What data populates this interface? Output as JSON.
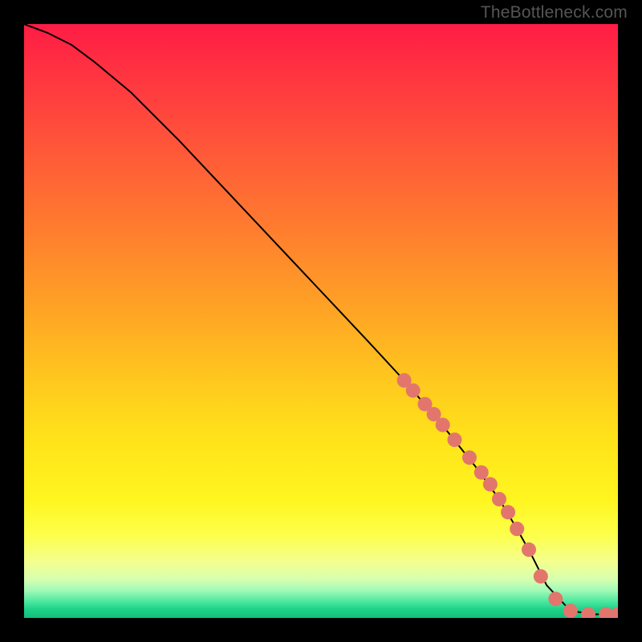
{
  "watermark": "TheBottleneck.com",
  "colors": {
    "frame": "#000000",
    "curve": "#000000",
    "marker_fill": "#e2766c",
    "marker_stroke": "#d46058",
    "gradient_stops": [
      {
        "offset": 0.0,
        "color": "#ff1c45"
      },
      {
        "offset": 0.1,
        "color": "#ff3840"
      },
      {
        "offset": 0.22,
        "color": "#ff5a38"
      },
      {
        "offset": 0.35,
        "color": "#ff7e2e"
      },
      {
        "offset": 0.48,
        "color": "#ffa325"
      },
      {
        "offset": 0.6,
        "color": "#ffc81e"
      },
      {
        "offset": 0.7,
        "color": "#ffe31a"
      },
      {
        "offset": 0.8,
        "color": "#fff51f"
      },
      {
        "offset": 0.86,
        "color": "#fdff4a"
      },
      {
        "offset": 0.905,
        "color": "#f4ff8e"
      },
      {
        "offset": 0.935,
        "color": "#d7ffb0"
      },
      {
        "offset": 0.955,
        "color": "#9cf9b6"
      },
      {
        "offset": 0.972,
        "color": "#4de8a0"
      },
      {
        "offset": 0.985,
        "color": "#1fd289"
      },
      {
        "offset": 1.0,
        "color": "#11bf7b"
      }
    ]
  },
  "chart_data": {
    "type": "line",
    "title": "",
    "xlabel": "",
    "ylabel": "",
    "xlim": [
      0,
      100
    ],
    "ylim": [
      0,
      100
    ],
    "series": [
      {
        "name": "bottleneck-curve",
        "x": [
          0,
          4,
          8,
          12,
          18,
          26,
          34,
          42,
          50,
          58,
          64,
          70,
          76,
          80,
          83,
          85.5,
          88,
          92,
          96,
          100
        ],
        "y": [
          100,
          98.5,
          96.5,
          93.5,
          88.5,
          80.5,
          72,
          63.5,
          55,
          46.5,
          40,
          33,
          25.5,
          20,
          15,
          10.5,
          5.5,
          1.2,
          0.6,
          0.6
        ]
      }
    ],
    "markers": {
      "name": "highlighted-points",
      "x": [
        64,
        65.5,
        67.5,
        69,
        70.5,
        72.5,
        75,
        77,
        78.5,
        80,
        81.5,
        83,
        85,
        87,
        89.5,
        92,
        95,
        98,
        100
      ],
      "y": [
        40,
        38.3,
        36,
        34.3,
        32.5,
        30,
        27,
        24.5,
        22.5,
        20,
        17.8,
        15,
        11.5,
        7,
        3.2,
        1.2,
        0.6,
        0.6,
        0.6
      ]
    }
  }
}
